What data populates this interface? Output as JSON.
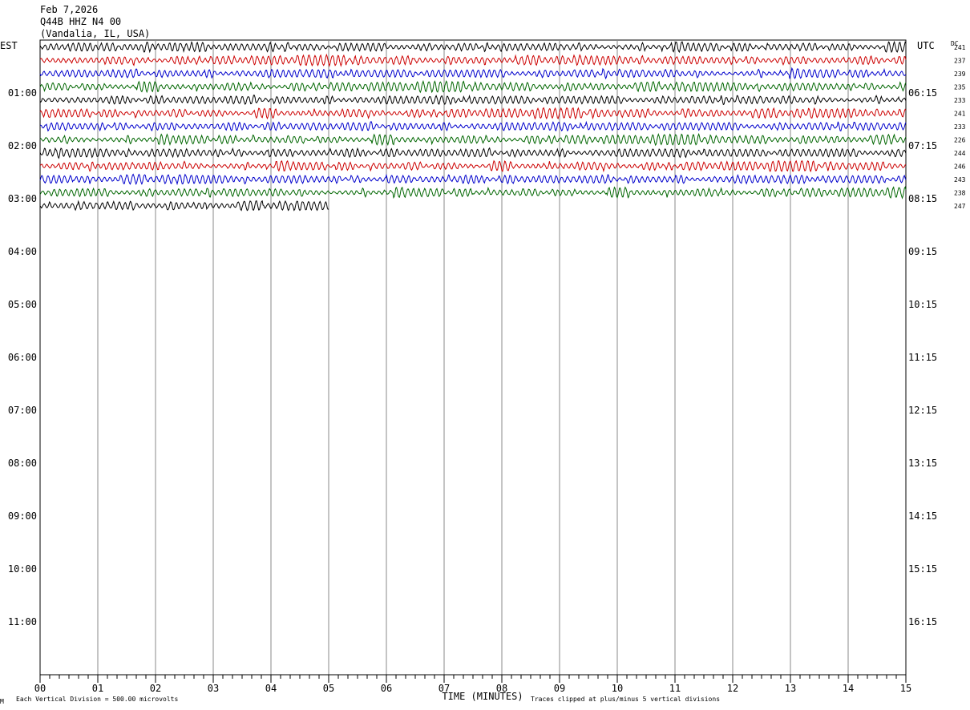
{
  "header": {
    "date": "Feb 7,2026",
    "station": "Q44B HHZ N4 00",
    "location": "(Vandalia, IL, USA)"
  },
  "left_tz": "EST",
  "right_tz": "UTC",
  "dc_label": "DC",
  "footer": {
    "scale_note": "Each Vertical Division =  500.00 microvolts",
    "clip_note": "Traces clipped at plus/minus 5 vertical divisions",
    "corner_mark": "M"
  },
  "chart_data": {
    "type": "line",
    "title": "",
    "xlabel": "TIME (MINUTES)",
    "x_ticks": [
      "00",
      "01",
      "02",
      "03",
      "04",
      "05",
      "06",
      "07",
      "08",
      "09",
      "10",
      "11",
      "12",
      "13",
      "14",
      "15"
    ],
    "xlim": [
      0,
      15
    ],
    "rows_total": 48,
    "row_colors": [
      "#000000",
      "#cc0000",
      "#0000cc",
      "#006600"
    ],
    "left_hour_labels": [
      "01:00",
      "02:00",
      "03:00",
      "04:00",
      "05:00",
      "06:00",
      "07:00",
      "08:00",
      "09:00",
      "10:00",
      "11:00"
    ],
    "right_hour_labels": [
      "06:15",
      "07:15",
      "08:15",
      "09:15",
      "10:15",
      "11:15",
      "12:15",
      "13:15",
      "14:15",
      "15:15",
      "16:15"
    ],
    "series": [
      {
        "row": 0,
        "color": "#000000",
        "dc": "241",
        "minutes": 15
      },
      {
        "row": 1,
        "color": "#cc0000",
        "dc": "237",
        "minutes": 15
      },
      {
        "row": 2,
        "color": "#0000cc",
        "dc": "239",
        "minutes": 15
      },
      {
        "row": 3,
        "color": "#006600",
        "dc": "235",
        "minutes": 15
      },
      {
        "row": 4,
        "color": "#000000",
        "dc": "233",
        "minutes": 15
      },
      {
        "row": 5,
        "color": "#cc0000",
        "dc": "241",
        "minutes": 15
      },
      {
        "row": 6,
        "color": "#0000cc",
        "dc": "233",
        "minutes": 15
      },
      {
        "row": 7,
        "color": "#006600",
        "dc": "226",
        "minutes": 15
      },
      {
        "row": 8,
        "color": "#000000",
        "dc": "244",
        "minutes": 15
      },
      {
        "row": 9,
        "color": "#cc0000",
        "dc": "246",
        "minutes": 15
      },
      {
        "row": 10,
        "color": "#0000cc",
        "dc": "243",
        "minutes": 15
      },
      {
        "row": 11,
        "color": "#006600",
        "dc": "238",
        "minutes": 15
      },
      {
        "row": 12,
        "color": "#000000",
        "dc": "247",
        "minutes": 5
      }
    ]
  }
}
